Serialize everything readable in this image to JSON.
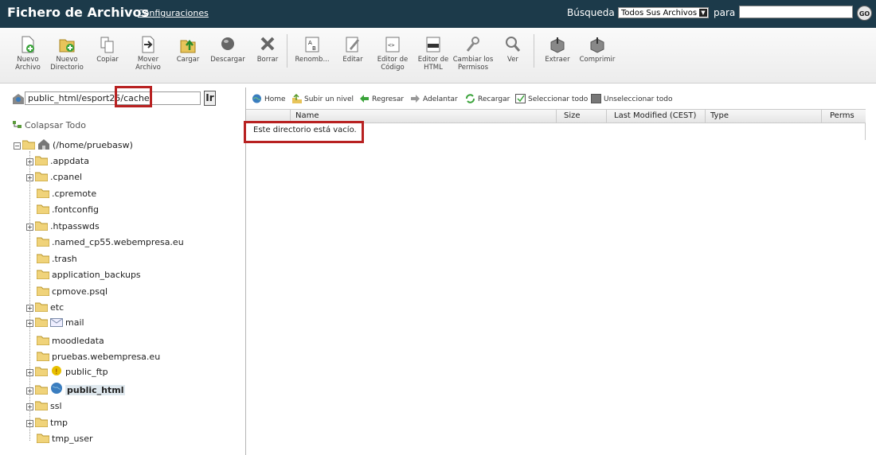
{
  "header": {
    "title": "Fichero de Archivos",
    "config_link": "Configuraciones",
    "search_label": "Búsqueda",
    "search_scope": "Todos Sus Archivos",
    "para_label": "para",
    "search_value": "",
    "go_label": "GO"
  },
  "toolbar": {
    "items": [
      {
        "label": "Nuevo Archivo",
        "icon": "new-file-icon"
      },
      {
        "label": "Nuevo Directorio",
        "icon": "new-folder-icon"
      },
      {
        "label": "Copiar",
        "icon": "copy-icon"
      },
      {
        "label": "Mover Archivo",
        "icon": "move-icon"
      },
      {
        "label": "Cargar",
        "icon": "upload-icon"
      },
      {
        "label": "Descargar",
        "icon": "download-icon"
      },
      {
        "label": "Borrar",
        "icon": "delete-icon"
      },
      {
        "label": "Renomb...",
        "icon": "rename-icon"
      },
      {
        "label": "Editar",
        "icon": "edit-icon"
      },
      {
        "label": "Editor de Código",
        "icon": "code-editor-icon"
      },
      {
        "label": "Editor de HTML",
        "icon": "html-editor-icon"
      },
      {
        "label": "Cambiar los Permisos",
        "icon": "permissions-icon"
      },
      {
        "label": "Ver",
        "icon": "view-icon"
      },
      {
        "label": "Extraer",
        "icon": "extract-icon"
      },
      {
        "label": "Comprimir",
        "icon": "compress-icon"
      }
    ]
  },
  "path": {
    "value": "public_html/esport25/cache",
    "go_label": "Ir"
  },
  "tree": {
    "collapse_label": "Colapsar Todo",
    "root": "(/home/pruebasw)",
    "items": [
      ".appdata",
      ".cpanel",
      ".cpremote",
      ".fontconfig",
      ".htpasswds",
      ".named_cp55.webempresa.eu",
      ".trash",
      "application_backups",
      "cpmove.psql",
      "etc",
      "mail",
      "moodledata",
      "pruebas.webempresa.eu",
      "public_ftp",
      "public_html",
      "ssl",
      "tmp",
      "tmp_user"
    ]
  },
  "nav": {
    "home": "Home",
    "up": "Subir un nivel",
    "back": "Regresar",
    "forward": "Adelantar",
    "reload": "Recargar",
    "select_all": "Seleccionar todo",
    "unselect_all": "Unseleccionar todo"
  },
  "grid": {
    "columns": [
      "Name",
      "Size",
      "Last Modified (CEST)",
      "Type",
      "Perms"
    ],
    "empty_message": "Este directorio está vacío."
  },
  "colors": {
    "header_bg": "#1c3a4a",
    "highlight": "#b82121"
  }
}
